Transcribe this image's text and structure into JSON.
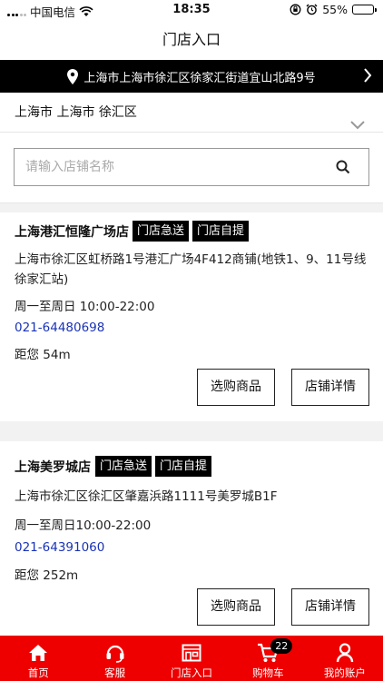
{
  "status_bar": {
    "carrier": "中国电信",
    "time": "18:35",
    "battery_label": "55%",
    "battery_level": 0.55
  },
  "nav": {
    "title": "门店入口"
  },
  "address": {
    "text": "上海市上海市徐汇区徐家汇街道宜山北路9号"
  },
  "region": {
    "text": "上海市 上海市 徐汇区"
  },
  "search": {
    "placeholder": "请输入店铺名称"
  },
  "stores": [
    {
      "name": "上海港汇恒隆广场店",
      "badges": [
        "门店急送",
        "门店自提"
      ],
      "address": "上海市徐汇区虹桥路1号港汇广场4F412商铺(地铁1、9、11号线徐家汇站)",
      "hours": "周一至周日 10:00-22:00",
      "phone": "021-64480698",
      "distance": "距您 54m",
      "buttons": {
        "shop": "选购商品",
        "detail": "店铺详情"
      }
    },
    {
      "name": "上海美罗城店",
      "badges": [
        "门店急送",
        "门店自提"
      ],
      "address": "上海市徐汇区徐汇区肇嘉浜路1111号美罗城B1F",
      "hours": "周一至周日10:00-22:00",
      "phone": "021-64391060",
      "distance": "距您 252m",
      "buttons": {
        "shop": "选购商品",
        "detail": "店铺详情"
      }
    }
  ],
  "tabbar": {
    "items": [
      {
        "label": "首页",
        "icon": "home-icon"
      },
      {
        "label": "客服",
        "icon": "headset-icon"
      },
      {
        "label": "门店入口",
        "icon": "store-icon"
      },
      {
        "label": "购物车",
        "icon": "cart-icon",
        "count": "22"
      },
      {
        "label": "我的账户",
        "icon": "user-icon"
      }
    ]
  },
  "colors": {
    "accent": "#ee0000",
    "dark": "#000000",
    "phone": "#1a33b8"
  }
}
